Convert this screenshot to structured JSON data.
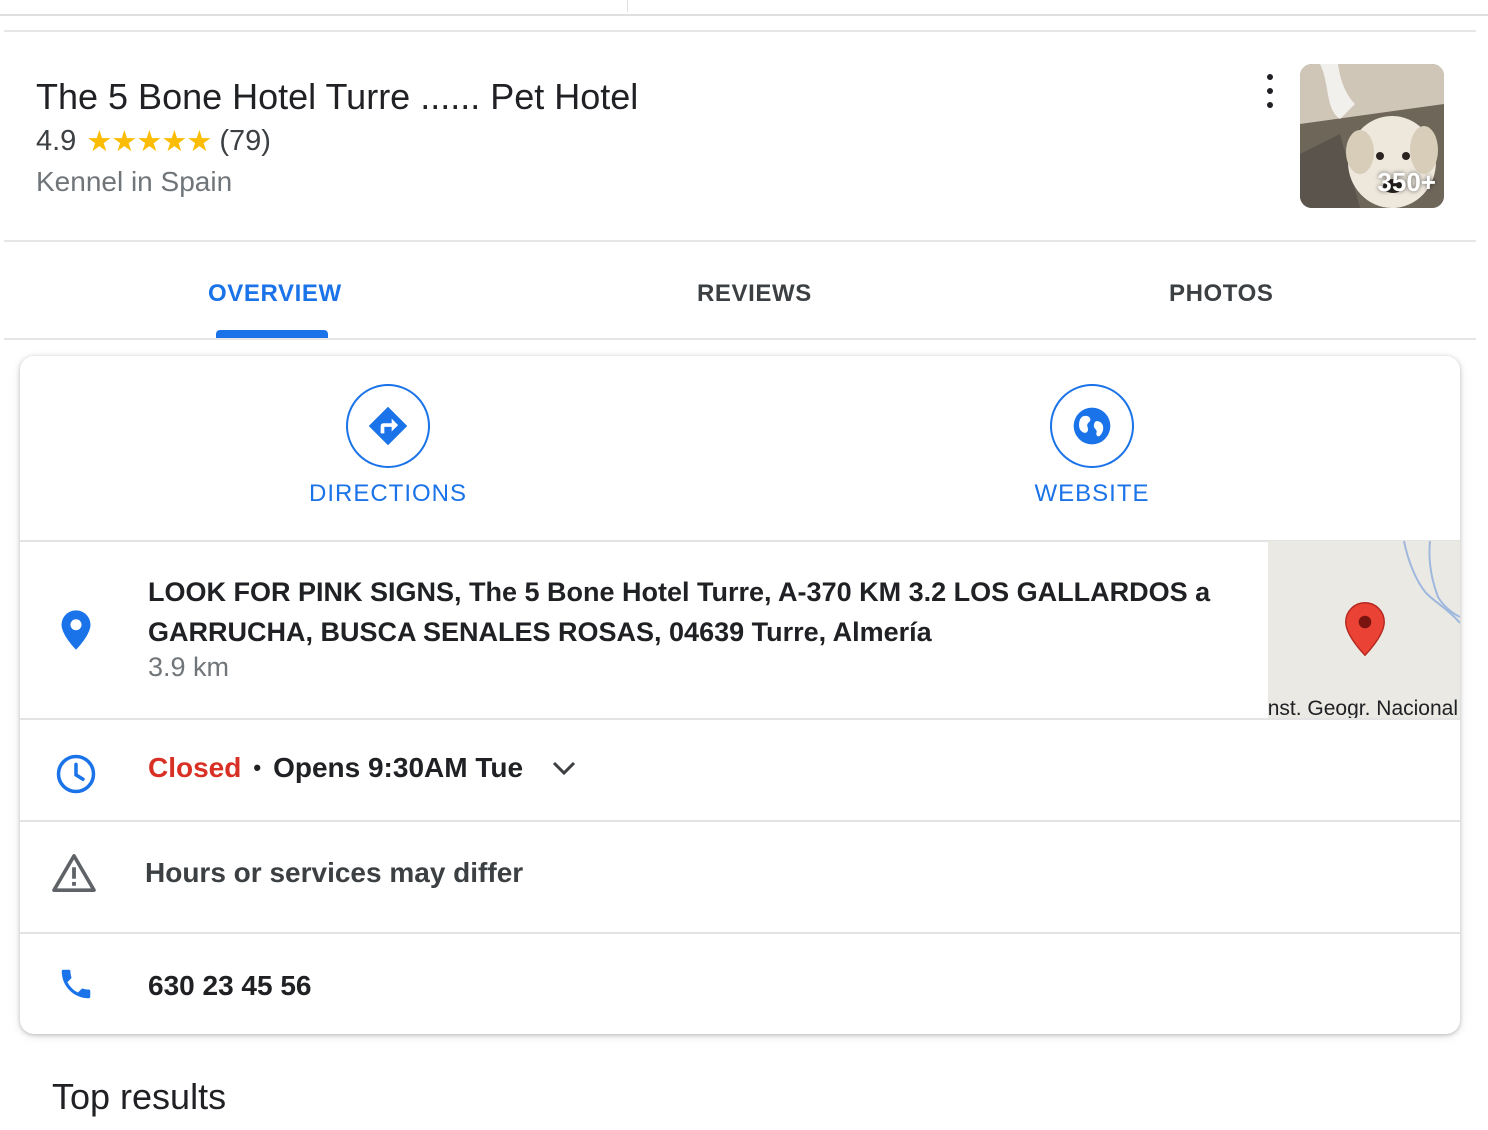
{
  "place": {
    "name": "The 5 Bone Hotel Turre ...... Pet Hotel",
    "rating": "4.9",
    "stars": "★★★★★",
    "review_count": "(79)",
    "category": "Kennel in Spain",
    "photo_count": "350+"
  },
  "tabs": [
    {
      "label": "OVERVIEW",
      "active": true
    },
    {
      "label": "REVIEWS",
      "active": false
    },
    {
      "label": "PHOTOS",
      "active": false
    }
  ],
  "actions": {
    "directions": "DIRECTIONS",
    "website": "WEBSITE"
  },
  "address": {
    "text": "LOOK FOR PINK SIGNS, The 5 Bone Hotel Turre, A-370 KM 3.2 LOS GALLARDOS a GARRUCHA, BUSCA SENALES ROSAS, 04639 Turre, Almería",
    "distance": "3.9 km",
    "map_credit": "Inst. Geogr. Nacional"
  },
  "hours": {
    "status": "Closed",
    "separator": "•",
    "next": "Opens 9:30AM Tue"
  },
  "notice": "Hours or services may differ",
  "phone": "630 23 45 56",
  "section_heading": "Top results",
  "colors": {
    "accent": "#1a73e8",
    "closed": "#d93025",
    "star": "#fbbc04",
    "map_pin": "#ea4335"
  },
  "icons": [
    "more-vert-icon",
    "directions-icon",
    "globe-icon",
    "location-pin-icon",
    "clock-icon",
    "chevron-down-icon",
    "warning-icon",
    "phone-icon"
  ]
}
